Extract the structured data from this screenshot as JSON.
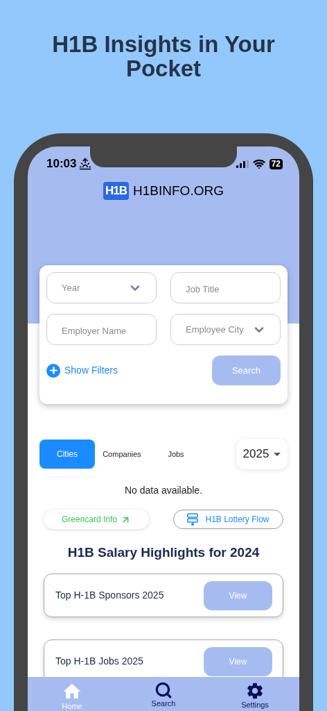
{
  "headline": "H1B Insights in Your Pocket",
  "status_bar": {
    "time": "10:03",
    "battery": "72"
  },
  "brand": {
    "logo": "H1B",
    "name": "H1BINFO.ORG"
  },
  "search_form": {
    "fields": [
      {
        "kind": "select",
        "placeholder": "Year"
      },
      {
        "kind": "text",
        "placeholder": "Job Title"
      },
      {
        "kind": "text",
        "placeholder": "Employer Name"
      },
      {
        "kind": "select",
        "placeholder": "Employee City"
      }
    ],
    "show_filters": "Show Filters",
    "search_button": "Search"
  },
  "tabs": [
    {
      "label": "Cities",
      "selected": true
    },
    {
      "label": "Companies",
      "selected": false
    },
    {
      "label": "Jobs",
      "selected": false
    }
  ],
  "year_select": "2025",
  "empty_message": "No data available.",
  "links": [
    {
      "kind": "external",
      "label": "Greencard Info"
    },
    {
      "kind": "flow",
      "label": "H1B Lottery Flow"
    }
  ],
  "section_title": "H1B Salary Highlights for 2024",
  "highlights": [
    {
      "title": "Top H-1B Sponsors 2025",
      "action": "View"
    },
    {
      "title": "Top H-1B Jobs 2025",
      "action": "View"
    }
  ],
  "nav": [
    {
      "kind": "home",
      "label": "Home",
      "selected": true
    },
    {
      "kind": "search",
      "label": "Search",
      "selected": false
    },
    {
      "kind": "settings",
      "label": "Settings",
      "selected": false
    }
  ]
}
